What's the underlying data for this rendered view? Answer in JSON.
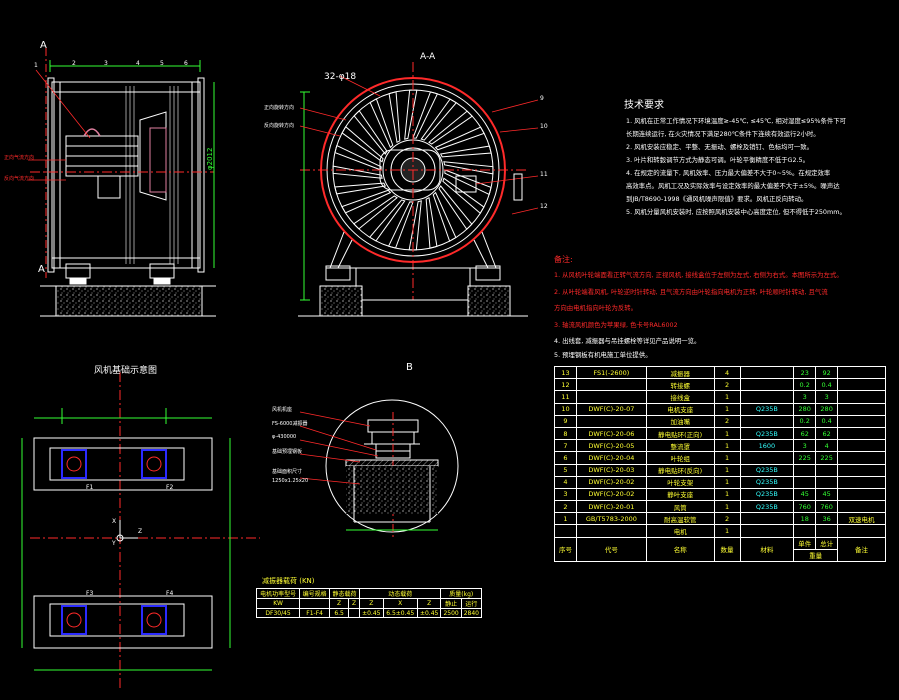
{
  "colors": {
    "background": "#000000",
    "outline": "#ffffff",
    "annotation": "#ff2a2a",
    "text": "#ffff33",
    "dimension": "#33ff33",
    "aux": "#33ffff",
    "motor_blue": "#2b2bff",
    "flange_pink": "#e080a0"
  },
  "views": {
    "section_mark_left_top": "A",
    "section_mark_left_bottom": "A",
    "section_title": "A-A",
    "bolt_callout": "32-φ18",
    "dim_vertical": "φ2012",
    "view_b_title": "B",
    "foundation_title": "风机基础示意图",
    "left_side_labels": [
      "正向气流方向",
      "反向气流方向"
    ],
    "aa_side_labels": [
      "正向旋转方向",
      "反向旋转方向"
    ],
    "left_item_numbers": [
      "1",
      "2",
      "3",
      "4",
      "5",
      "6"
    ],
    "aa_item_numbers": [
      "9",
      "10",
      "11",
      "12"
    ],
    "view_b_labels": [
      "风机机座",
      "FS-6000减振器",
      "φ-430000",
      "基础预埋钢板",
      "基础面积尺寸",
      "1250x1.25x20"
    ],
    "foundation_marks": [
      "F1",
      "F2",
      "F3",
      "F4",
      "X",
      "Y",
      "Z"
    ]
  },
  "tech_title": "技术要求",
  "tech_lines": [
    "1. 风机在正常工作情况下环境温度≥-45℃, ≤45℃, 相对湿度≤95%条件下可",
    "长期连续运行, 在火灾情况下满足280℃条件下连续有效运行2小时。",
    "2. 风机安装应稳定、平整、无振动、螺栓及销钉、色标均可一致。",
    "3. 叶片和转毂调节方式为静态可调。叶轮平衡精度不低于G2.5。",
    "4. 在规定的流量下, 风机效率、压力最大偏差不大于0~5%。在规定效率",
    "高效率点。风机工况及实际效率与设定效率的最大偏差不大于±5%。噪声达",
    "到JB/T8690-1998《通风机噪声限值》要求。风机正反向转动。",
    "5. 风机分量风机安装时, 应按照风机安装中心高度定位, 但不得低于250mm。"
  ],
  "notes_title": "备注:",
  "notes_lines": [
    {
      "text": "1. 从风机叶轮端面看正转气流方向, 正视风机, 接线盒位于左侧为左式, 右侧为右式。本图所示为左式。",
      "color": "r"
    },
    {
      "text": "2. 从叶轮端看风机, 叶轮逆时针转动, 且气流方向由叶轮指向电机为正转, 叶轮顺时针转动, 且气流",
      "color": "r"
    },
    {
      "text": "方向由电机指向叶轮为反转。",
      "color": "r"
    },
    {
      "text": "3. 轴流风机颜色为苹果绿, 色卡号RAL6002",
      "color": "r"
    },
    {
      "text": "4. 出线套, 减振器与吊挂螺栓等详见产品说明一览。",
      "color": "w"
    },
    {
      "text": "5. 预埋钢板有机电施工单位提供。",
      "color": "w"
    }
  ],
  "bom": {
    "rows": [
      [
        "13",
        "FS1(-2600)",
        "减振器",
        "4",
        "",
        "23",
        "92",
        ""
      ],
      [
        "12",
        "",
        "转接螺",
        "2",
        "",
        "0.2",
        "0.4",
        ""
      ],
      [
        "11",
        "",
        "接线盒",
        "1",
        "",
        "3",
        "3",
        ""
      ],
      [
        "10",
        "DWF(C)-20-07",
        "电机支座",
        "1",
        "Q235B",
        "280",
        "280",
        ""
      ],
      [
        "9",
        "",
        "加油嘴",
        "2",
        "",
        "0.2",
        "0.4",
        ""
      ],
      [
        "8",
        "DWF(C)-20-06",
        "静电贴环(正向)",
        "1",
        "Q235B",
        "62",
        "62",
        ""
      ],
      [
        "7",
        "DWF(C)-20-05",
        "整流罩",
        "1",
        "1600",
        "3",
        "4",
        ""
      ],
      [
        "6",
        "DWF(C)-20-04",
        "叶轮组",
        "1",
        "",
        "225",
        "225",
        ""
      ],
      [
        "5",
        "DWF(C)-20-03",
        "静电贴环(反向)",
        "1",
        "Q235B",
        "",
        "",
        ""
      ],
      [
        "4",
        "DWF(C)-20-02",
        "叶轮支架",
        "1",
        "Q235B",
        "",
        "",
        ""
      ],
      [
        "3",
        "DWF(C)-20-02",
        "静叶支座",
        "1",
        "Q235B",
        "45",
        "45",
        ""
      ],
      [
        "2",
        "DWF(C)-20-01",
        "风筒",
        "1",
        "Q235B",
        "760",
        "760",
        ""
      ],
      [
        "1",
        "GB/T5783-2000",
        "耐高温软管",
        "2",
        "",
        "18",
        "36",
        "双速电机"
      ],
      [
        "",
        "",
        "电机",
        "1",
        "",
        "",
        "",
        ""
      ]
    ],
    "header": {
      "no": "序号",
      "code": "代号",
      "name": "名称",
      "qty": "数量",
      "material": "材料",
      "single": "单件",
      "total": "总计",
      "weight": "重量",
      "remark": "备注"
    }
  },
  "damper": {
    "title": "减振器载荷 (KN)",
    "h1": [
      "电机功率型号",
      "编号规格",
      "静态载荷",
      "动态载荷",
      "质量(kg)"
    ],
    "h2": [
      "KW",
      "",
      "Z",
      "Z",
      "Z",
      "X",
      "Z",
      "静止",
      "运行"
    ],
    "row": [
      "DF30/45",
      "F1-F4",
      "6.5",
      "",
      "±0.45",
      "6.5±0.45",
      "±0.45",
      "2500",
      "2840"
    ]
  }
}
